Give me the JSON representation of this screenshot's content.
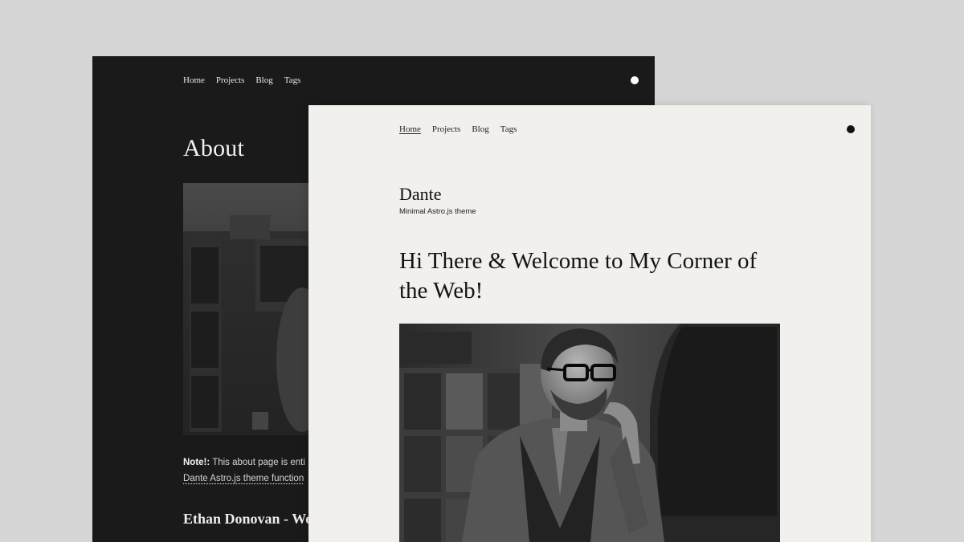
{
  "dark_page": {
    "nav": [
      "Home",
      "Projects",
      "Blog",
      "Tags"
    ],
    "title": "About",
    "note_label": "Note!:",
    "note_text": " This about page is enti",
    "note_link": "Dante Astro.js theme function",
    "person_heading": "Ethan Donovan - We",
    "colors": {
      "background": "#1a1a1a",
      "text": "#f2f2f2",
      "toggle": "#ffffff"
    }
  },
  "light_page": {
    "nav": [
      "Home",
      "Projects",
      "Blog",
      "Tags"
    ],
    "active_nav": "Home",
    "site_name": "Dante",
    "site_tagline": "Minimal Astro.js theme",
    "hero_title": "Hi There & Welcome to My Corner of the Web!",
    "colors": {
      "background": "#f1f0ec",
      "text": "#141414",
      "toggle": "#111111"
    }
  },
  "icons": {
    "theme_toggle": "circle-dot-icon"
  },
  "background_color": "#d6d6d6"
}
